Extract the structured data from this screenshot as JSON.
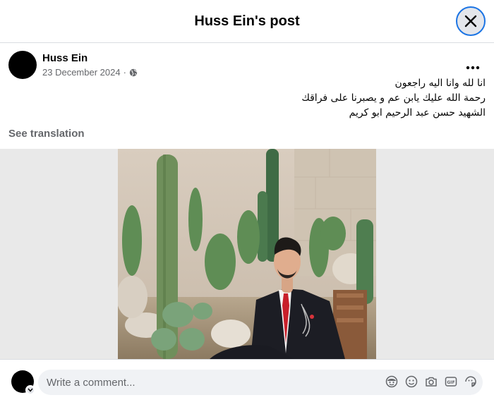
{
  "header": {
    "title": "Huss Ein's post"
  },
  "post": {
    "author": "Huss Ein",
    "date": "23 December 2024",
    "separator": "·",
    "privacy_icon": "globe-icon",
    "text_lines": [
      "انا لله وانا اليه راجعون",
      "رحمة الله عليك يابن عم و يصبرنا على فراقك",
      "الشهيد حسن عبد الرحيم ابو كريم"
    ],
    "see_translation": "See translation"
  },
  "composer": {
    "placeholder": "Write a comment...",
    "icons": [
      "avatar-sticker-icon",
      "emoji-icon",
      "camera-icon",
      "gif-icon",
      "sticker-icon"
    ]
  },
  "colors": {
    "accent": "#1b74e4",
    "secondary_text": "#65676b",
    "comment_bg": "#f0f2f5"
  }
}
